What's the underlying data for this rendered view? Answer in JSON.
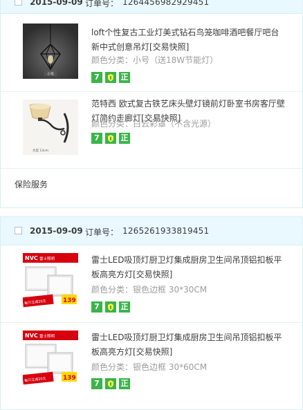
{
  "orders": [
    {
      "date": "2015-09-09",
      "order_label": "订单号：",
      "order_id": "1264456982929451",
      "items": [
        {
          "title": "loft个性复古工业灯美式钻石鸟笼咖啡酒吧餐厅吧台新中式创意吊灯[交易快照]",
          "sku": "颜色分类：小号（送18W节能灯）",
          "thumb_icon": "pendant-lamp-photo",
          "thumb_caption": "小号",
          "badges": [
            "seven-day-return-icon",
            "guarantee-icon",
            "genuine-icon"
          ],
          "badge_7": "7",
          "badge_zheng": "正"
        },
        {
          "title": "范特西 欧式复古铁艺床头壁灯镜前灯卧室书房客厅壁灯简约走廊灯[交易快照]",
          "sku": "颜色分类：白云彩罩（不含光源）",
          "thumb_icon": "wall-lamp-photo",
          "thumb_caption": "大蕊 13cm",
          "badges": [
            "seven-day-return-icon",
            "guarantee-icon",
            "genuine-icon"
          ],
          "badge_7": "7",
          "badge_zheng": "正"
        }
      ],
      "service": "保险服务"
    },
    {
      "date": "2015-09-09",
      "order_label": "订单号：",
      "order_id": "1265261933819451",
      "items": [
        {
          "title": "雷士LED吸顶灯厨卫灯集成厨房卫生间吊顶铝扣板平板高亮方灯[交易快照]",
          "sku": "颜色分类：银色边框 30*30CM",
          "thumb_icon": "led-panel-photo",
          "thumb_brand": "NVC",
          "thumb_store": "雷士照明",
          "thumb_promo": "每只立减20元",
          "thumb_price": "139",
          "badges": [
            "seven-day-return-icon",
            "guarantee-icon",
            "genuine-icon"
          ],
          "badge_7": "7",
          "badge_zheng": "正"
        },
        {
          "title": "雷士LED吸顶灯厨卫灯集成厨房卫生间吊顶铝扣板平板高亮方灯[交易快照]",
          "sku": "颜色分类：银色边框 30*60CM",
          "thumb_icon": "led-panel-photo",
          "thumb_brand": "NVC",
          "thumb_store": "雷士照明",
          "thumb_promo": "每只立减20元",
          "thumb_price": "139",
          "badges": [
            "seven-day-return-icon",
            "guarantee-icon",
            "genuine-icon"
          ],
          "badge_7": "7",
          "badge_zheng": "正"
        }
      ]
    }
  ],
  "colors": {
    "header_bg": "#eaf8ff",
    "badge_green": "#3bb44a",
    "muted_text": "#9c9c9c",
    "nvc_red": "#d7000f"
  }
}
